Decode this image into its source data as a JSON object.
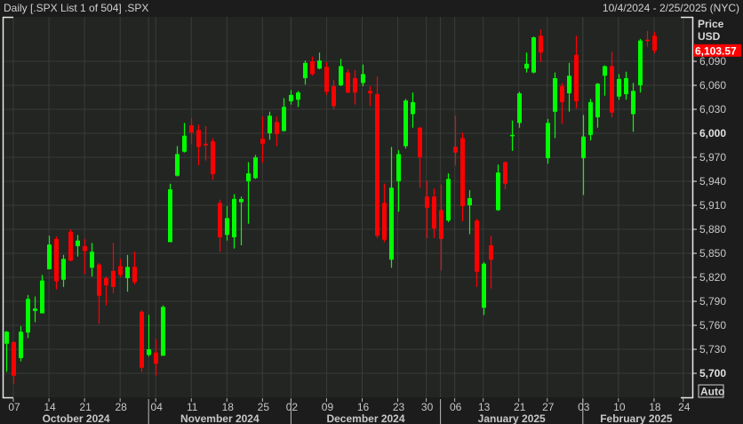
{
  "header": {
    "title": "Daily [.SPX List 1 of 504] .SPX",
    "date_range": "10/4/2024 - 2/25/2025 (NYC)"
  },
  "axis": {
    "price_label": "Price",
    "currency_label": "USD",
    "last_price_label": "6,103.57",
    "auto_button": "Auto"
  },
  "colors": {
    "up": "#00ff00",
    "down": "#ff0000",
    "last_price_bg": "#ff0000"
  },
  "chart_data": {
    "type": "candlestick",
    "title": "Daily .SPX",
    "ylabel": "Price USD",
    "ylim": [
      5685,
      6140
    ],
    "last_price": 6103.57,
    "grid": true,
    "y_ticks": [
      5700,
      5730,
      5760,
      5790,
      5820,
      5850,
      5880,
      5910,
      5940,
      5970,
      6000,
      6030,
      6060,
      6090
    ],
    "y_tick_labels": [
      "5,700",
      "5,730",
      "5,760",
      "5,790",
      "5,820",
      "5,850",
      "5,880",
      "5,910",
      "5,940",
      "5,970",
      "6,000",
      "6,030",
      "6,060",
      "6,090"
    ],
    "x_ticks": [
      {
        "label": "07",
        "index": 1
      },
      {
        "label": "14",
        "index": 6
      },
      {
        "label": "21",
        "index": 11
      },
      {
        "label": "28",
        "index": 16
      },
      {
        "label": "04",
        "index": 21
      },
      {
        "label": "11",
        "index": 26
      },
      {
        "label": "18",
        "index": 31
      },
      {
        "label": "25",
        "index": 36
      },
      {
        "label": "02",
        "index": 40
      },
      {
        "label": "09",
        "index": 45
      },
      {
        "label": "16",
        "index": 50
      },
      {
        "label": "23",
        "index": 55
      },
      {
        "label": "30",
        "index": 59
      },
      {
        "label": "06",
        "index": 63
      },
      {
        "label": "13",
        "index": 67
      },
      {
        "label": "21",
        "index": 72
      },
      {
        "label": "27",
        "index": 76
      },
      {
        "label": "03",
        "index": 81
      },
      {
        "label": "10",
        "index": 86
      },
      {
        "label": "18",
        "index": 91
      },
      {
        "label": "24",
        "index": 95.1
      }
    ],
    "months": [
      {
        "label": "October 2024",
        "start": -1,
        "end": 20
      },
      {
        "label": "November 2024",
        "start": 20,
        "end": 40
      },
      {
        "label": "December 2024",
        "start": 40,
        "end": 61
      },
      {
        "label": "January 2025",
        "start": 61,
        "end": 81
      },
      {
        "label": "February 2025",
        "start": 81,
        "end": 96
      }
    ],
    "columns": [
      "date",
      "open",
      "high",
      "low",
      "close"
    ],
    "candles": [
      [
        "2024-10-04",
        5737,
        5753,
        5702,
        5752
      ],
      [
        "2024-10-07",
        5739,
        5740,
        5687,
        5697
      ],
      [
        "2024-10-08",
        5719,
        5759,
        5715,
        5752
      ],
      [
        "2024-10-09",
        5751,
        5798,
        5744,
        5793
      ],
      [
        "2024-10-10",
        5778,
        5796,
        5764,
        5781
      ],
      [
        "2024-10-11",
        5775,
        5823,
        5775,
        5816
      ],
      [
        "2024-10-14",
        5830,
        5872,
        5830,
        5861
      ],
      [
        "2024-10-15",
        5868,
        5871,
        5805,
        5815
      ],
      [
        "2024-10-16",
        5817,
        5848,
        5808,
        5843
      ],
      [
        "2024-10-17",
        5877,
        5880,
        5840,
        5841
      ],
      [
        "2024-10-18",
        5859,
        5873,
        5846,
        5866
      ],
      [
        "2024-10-21",
        5859,
        5868,
        5824,
        5853
      ],
      [
        "2024-10-22",
        5832,
        5863,
        5821,
        5852
      ],
      [
        "2024-10-23",
        5836,
        5838,
        5762,
        5797
      ],
      [
        "2024-10-24",
        5819,
        5821,
        5785,
        5810
      ],
      [
        "2024-10-25",
        5828,
        5863,
        5800,
        5808
      ],
      [
        "2024-10-28",
        5834,
        5843,
        5820,
        5823
      ],
      [
        "2024-10-29",
        5819,
        5848,
        5802,
        5833
      ],
      [
        "2024-10-30",
        5833,
        5852,
        5811,
        5814
      ],
      [
        "2024-10-31",
        5777,
        5779,
        5702,
        5707
      ],
      [
        "2024-11-01",
        5723,
        5773,
        5721,
        5730
      ],
      [
        "2024-11-04",
        5726,
        5743,
        5697,
        5712
      ],
      [
        "2024-11-05",
        5722,
        5785,
        5722,
        5783
      ],
      [
        "2024-11-06",
        5864,
        5937,
        5864,
        5930
      ],
      [
        "2024-11-07",
        5947,
        5984,
        5946,
        5974
      ],
      [
        "2024-11-08",
        5977,
        6013,
        5976,
        5997
      ],
      [
        "2024-11-11",
        6010,
        6019,
        5987,
        6001
      ],
      [
        "2024-11-12",
        6004,
        6011,
        5960,
        5983
      ],
      [
        "2024-11-13",
        5987,
        6009,
        5966,
        5985
      ],
      [
        "2024-11-14",
        5990,
        5994,
        5942,
        5949
      ],
      [
        "2024-11-15",
        5913,
        5917,
        5852,
        5870
      ],
      [
        "2024-11-18",
        5873,
        5909,
        5866,
        5894
      ],
      [
        "2024-11-19",
        5870,
        5924,
        5856,
        5918
      ],
      [
        "2024-11-20",
        5914,
        5921,
        5860,
        5918
      ],
      [
        "2024-11-21",
        5940,
        5964,
        5887,
        5950
      ],
      [
        "2024-11-22",
        5944,
        5973,
        5943,
        5970
      ],
      [
        "2024-11-25",
        5993,
        6021,
        5963,
        5987
      ],
      [
        "2024-11-26",
        6000,
        6027,
        5992,
        6022
      ],
      [
        "2024-11-27",
        6014,
        6021,
        5984,
        5999
      ],
      [
        "2024-11-29",
        6003,
        6044,
        6002,
        6033
      ],
      [
        "2024-12-02",
        6040,
        6054,
        6036,
        6048
      ],
      [
        "2024-12-03",
        6042,
        6053,
        6033,
        6051
      ],
      [
        "2024-12-04",
        6069,
        6091,
        6061,
        6088
      ],
      [
        "2024-12-05",
        6090,
        6096,
        6072,
        6074
      ],
      [
        "2024-12-06",
        6081,
        6101,
        6080,
        6091
      ],
      [
        "2024-12-09",
        6083,
        6089,
        6048,
        6052
      ],
      [
        "2024-12-10",
        6059,
        6067,
        6030,
        6034
      ],
      [
        "2024-12-11",
        6060,
        6093,
        6059,
        6084
      ],
      [
        "2024-12-12",
        6076,
        6080,
        6050,
        6051
      ],
      [
        "2024-12-13",
        6069,
        6079,
        6036,
        6051
      ],
      [
        "2024-12-16",
        6063,
        6086,
        6059,
        6074
      ],
      [
        "2024-12-17",
        6053,
        6059,
        6034,
        6050
      ],
      [
        "2024-12-18",
        6049,
        6071,
        5869,
        5872
      ],
      [
        "2024-12-19",
        5913,
        5937,
        5864,
        5867
      ],
      [
        "2024-12-20",
        5842,
        5983,
        5832,
        5932
      ],
      [
        "2024-12-23",
        5940,
        5979,
        5902,
        5974
      ],
      [
        "2024-12-24",
        5984,
        6043,
        5981,
        6041
      ],
      [
        "2024-12-26",
        6024,
        6051,
        6007,
        6039
      ],
      [
        "2024-12-27",
        6007,
        6008,
        5932,
        5970
      ],
      [
        "2024-12-30",
        5921,
        5941,
        5869,
        5907
      ],
      [
        "2024-12-31",
        5921,
        5931,
        5869,
        5881
      ],
      [
        "2025-01-02",
        5904,
        5936,
        5829,
        5868
      ],
      [
        "2025-01-03",
        5891,
        5950,
        5889,
        5943
      ],
      [
        "2025-01-06",
        5983,
        6022,
        5960,
        5976
      ],
      [
        "2025-01-07",
        5994,
        6001,
        5890,
        5909
      ],
      [
        "2025-01-08",
        5910,
        5929,
        5874,
        5919
      ],
      [
        "2025-01-10",
        5891,
        5893,
        5808,
        5827
      ],
      [
        "2025-01-13",
        5782,
        5839,
        5773,
        5837
      ],
      [
        "2025-01-14",
        5860,
        5872,
        5806,
        5842
      ],
      [
        "2025-01-15",
        5904,
        5961,
        5903,
        5951
      ],
      [
        "2025-01-16",
        5964,
        5965,
        5930,
        5937
      ],
      [
        "2025-01-17",
        5997,
        6016,
        5978,
        5998
      ],
      [
        "2025-01-21",
        6013,
        6052,
        6007,
        6050
      ],
      [
        "2025-01-22",
        6081,
        6101,
        6076,
        6087
      ],
      [
        "2025-01-23",
        6076,
        6121,
        6075,
        6120
      ],
      [
        "2025-01-24",
        6122,
        6130,
        6089,
        6101
      ],
      [
        "2025-01-27",
        5969,
        6018,
        5962,
        6013
      ],
      [
        "2025-01-28",
        6027,
        6076,
        5994,
        6069
      ],
      [
        "2025-01-29",
        6059,
        6063,
        6012,
        6039
      ],
      [
        "2025-01-30",
        6050,
        6088,
        6027,
        6072
      ],
      [
        "2025-01-31",
        6098,
        6122,
        6031,
        6040
      ],
      [
        "2025-02-03",
        5969,
        6023,
        5923,
        5996
      ],
      [
        "2025-02-04",
        5998,
        6043,
        5991,
        6039
      ],
      [
        "2025-02-05",
        6020,
        6063,
        6007,
        6062
      ],
      [
        "2025-02-06",
        6072,
        6085,
        6047,
        6084
      ],
      [
        "2025-02-07",
        6084,
        6102,
        6020,
        6026
      ],
      [
        "2025-02-10",
        6046,
        6074,
        6042,
        6068
      ],
      [
        "2025-02-11",
        6049,
        6077,
        6042,
        6069
      ],
      [
        "2025-02-12",
        6024,
        6063,
        6002,
        6053
      ],
      [
        "2025-02-13",
        6060,
        6118,
        6051,
        6116
      ],
      [
        "2025-02-14",
        6117,
        6128,
        6108,
        6116
      ],
      [
        "2025-02-18",
        6122,
        6127,
        6100,
        6103.57
      ]
    ]
  }
}
